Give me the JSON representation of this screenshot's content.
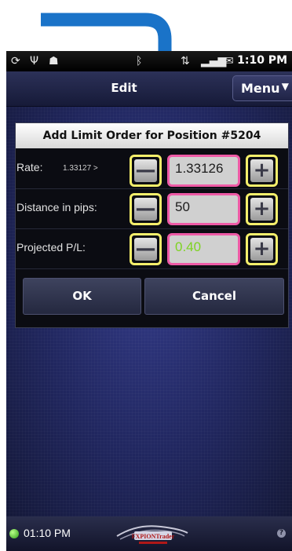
{
  "status_bar": {
    "time": "1:10 PM"
  },
  "title_bar": {
    "title": "Edit",
    "menu_label": "Menu"
  },
  "dialog": {
    "title": "Add Limit Order for Position #5204",
    "rows": [
      {
        "label": "Rate:",
        "sub": "1.33127 >",
        "value": "1.33126",
        "value_color": "#1c1c1c"
      },
      {
        "label": "Distance in pips:",
        "value": "50",
        "value_color": "#1c1c1c"
      },
      {
        "label": "Projected P/L:",
        "value": "0.40",
        "value_color": "#7ed321"
      }
    ],
    "minus_glyph": "—",
    "plus_glyph": "+",
    "ok_label": "OK",
    "cancel_label": "Cancel"
  },
  "bottom_bar": {
    "clock": "01:10 PM",
    "logo_text": "FXPIONTrader",
    "help_glyph": "?"
  },
  "colors": {
    "highlight_yellow": "#f5ef6b",
    "highlight_pink": "#ee5aa6",
    "annotation_arrow": "#1a73c8",
    "pl_green": "#7ed321"
  }
}
